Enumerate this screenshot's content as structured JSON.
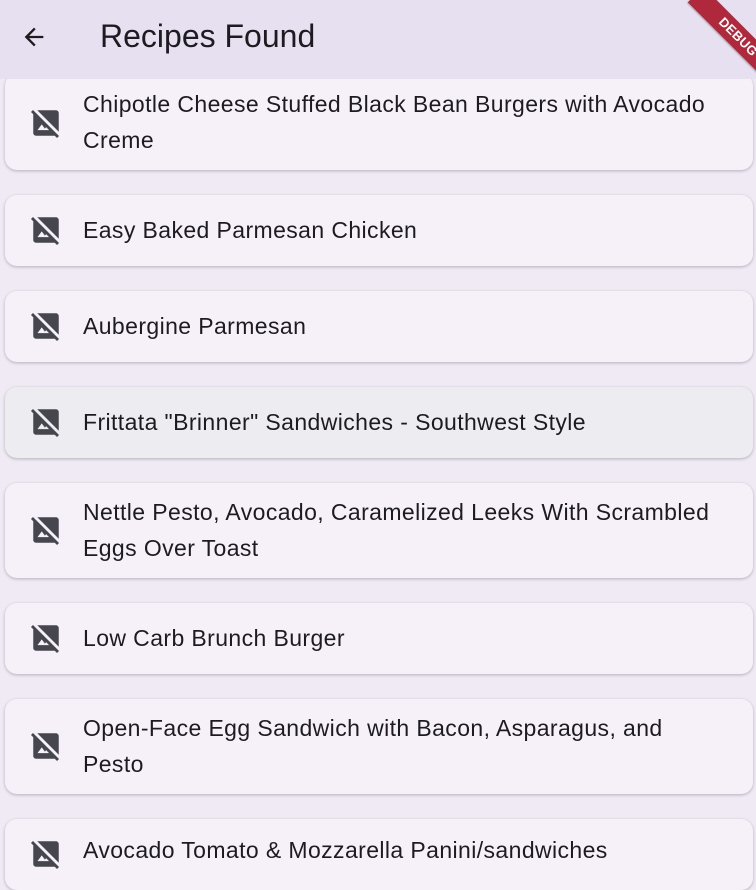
{
  "app_bar": {
    "title": "Recipes Found",
    "back_icon": "arrow-back-icon",
    "background": "#e7e0f0"
  },
  "debug_banner": "DEBUG",
  "colors": {
    "page_background": "#f0eaf5",
    "card_background": "#f6f1f9",
    "pressed_card_background": "#ececf1",
    "icon_color": "#46464f",
    "debug_banner": "#b0283c"
  },
  "recipes": [
    {
      "title": "Chipotle Cheese Stuffed Black Bean Burgers with Avocado Creme",
      "icon": "hide-image-icon"
    },
    {
      "title": "Easy Baked Parmesan Chicken",
      "icon": "hide-image-icon"
    },
    {
      "title": "Aubergine Parmesan",
      "icon": "hide-image-icon"
    },
    {
      "title": "Frittata \"Brinner\" Sandwiches - Southwest Style",
      "icon": "hide-image-icon",
      "pressed": true
    },
    {
      "title": "Nettle Pesto, Avocado, Caramelized Leeks With Scrambled Eggs Over Toast",
      "icon": "hide-image-icon"
    },
    {
      "title": "Low Carb Brunch Burger",
      "icon": "hide-image-icon"
    },
    {
      "title": "Open-Face Egg Sandwich with Bacon, Asparagus, and Pesto",
      "icon": "hide-image-icon"
    },
    {
      "title": "Avocado Tomato & Mozzarella Panini/sandwiches",
      "icon": "hide-image-icon"
    }
  ]
}
